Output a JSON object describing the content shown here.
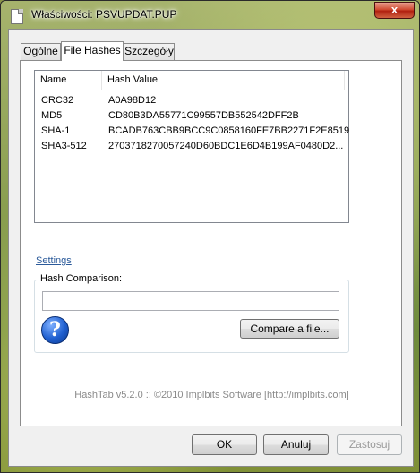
{
  "window": {
    "title": "Właściwości: PSVUPDAT.PUP",
    "close_label": "x"
  },
  "tabs": [
    {
      "label": "Ogólne",
      "active": false
    },
    {
      "label": "File Hashes",
      "active": true
    },
    {
      "label": "Szczegóły",
      "active": false
    }
  ],
  "hash_list": {
    "columns": [
      "Name",
      "Hash Value"
    ],
    "rows": [
      {
        "name": "CRC32",
        "value": "A0A98D12"
      },
      {
        "name": "MD5",
        "value": "CD80B3DA55771C99557DB552542DFF2B"
      },
      {
        "name": "SHA-1",
        "value": "BCADB763CBB9BCC9C0858160FE7BB2271F2E8519"
      },
      {
        "name": "SHA3-512",
        "value": "2703718270057240D60BDC1E6D4B199AF0480D2..."
      }
    ]
  },
  "settings_link": "Settings",
  "hash_comparison": {
    "label": "Hash Comparison:",
    "input_value": "",
    "help_icon": "question-mark-icon",
    "compare_button": "Compare a file..."
  },
  "credit": "HashTab v5.2.0 :: ©2010 Implbits Software [http://implbits.com]",
  "buttons": {
    "ok": "OK",
    "cancel": "Anuluj",
    "apply": "Zastosuj"
  },
  "colors": {
    "link": "#2b5a9a",
    "close_button": "#c8381c",
    "credit_text": "#8a8a8a"
  }
}
